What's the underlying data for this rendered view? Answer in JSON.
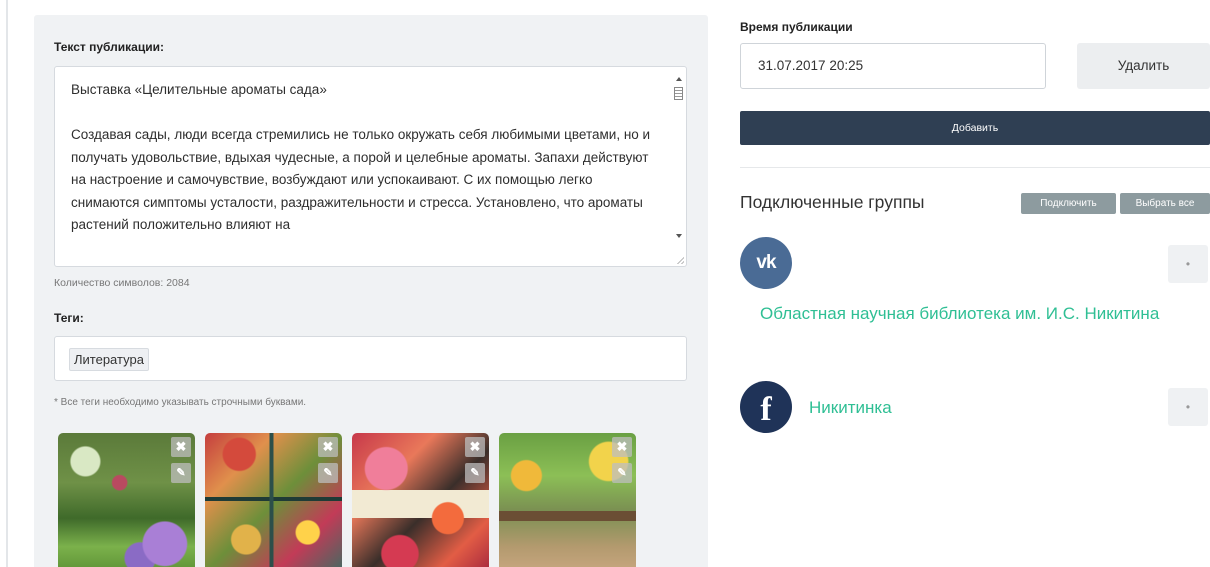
{
  "post": {
    "text_label": "Текст публикации:",
    "text_value": "Выставка «Целительные ароматы сада»\n\nСоздавая сады, люди всегда стремились не только окружать себя любимыми цветами, но и получать удовольствие, вдыхая чудесные, а порой и целебные ароматы. Запахи действуют на настроение и самочувствие, возбуждают или успокаивают. С их помощью легко снимаются симптомы усталости, раздражительности и стресса. Установлено, что ароматы растений положительно влияют на",
    "char_count": "Количество символов: 2084"
  },
  "tags": {
    "label": "Теги:",
    "items": [
      "Литература"
    ],
    "note": "* Все теги необходимо указывать строчными буквами."
  },
  "images": [
    {
      "alt": "garden-photo",
      "close_icon": "✖",
      "edit_icon": "✎"
    },
    {
      "alt": "magazines-photo",
      "close_icon": "✖",
      "edit_icon": "✎"
    },
    {
      "alt": "flower-books-photo",
      "close_icon": "✖",
      "edit_icon": "✎"
    },
    {
      "alt": "patio-photo",
      "close_icon": "✖",
      "edit_icon": "✎"
    }
  ],
  "publish": {
    "time_label": "Время публикации",
    "time_value": "31.07.2017 20:25",
    "delete_label": "Удалить",
    "add_label": "Добавить"
  },
  "groups": {
    "title": "Подключенные группы",
    "connect_label": "Подключить",
    "select_all_label": "Выбрать все",
    "items": [
      {
        "network": "vk",
        "icon_glyph": "vk",
        "name": "Областная научная библиотека им. И.С. Никитина",
        "action_glyph": "•"
      },
      {
        "network": "facebook",
        "icon_glyph": "f",
        "name": "Никитинка",
        "action_glyph": "•"
      }
    ]
  },
  "colors": {
    "accent_dark": "#2f3f53",
    "link_green": "#2fbf94",
    "vk_blue": "#4a6b95",
    "fb_navy": "#1f3358",
    "muted_button": "#8d9b9f"
  }
}
